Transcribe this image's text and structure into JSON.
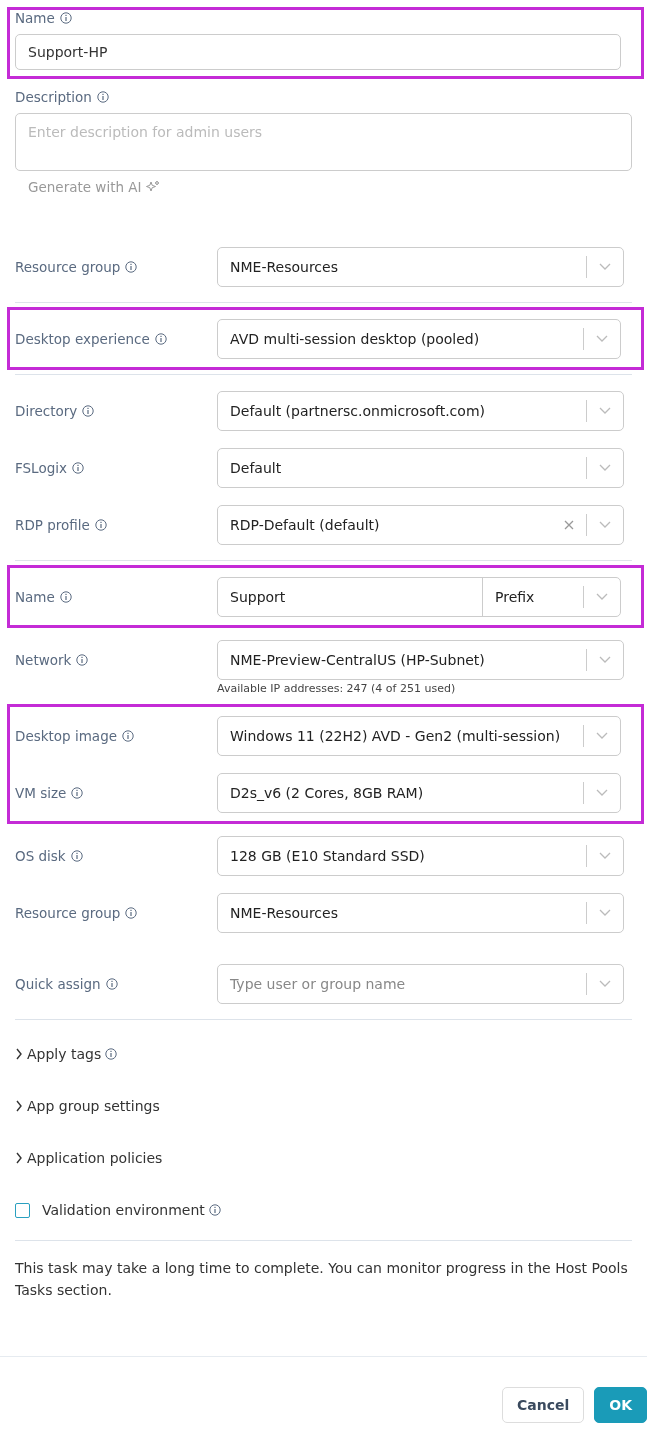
{
  "name_field": {
    "label": "Name",
    "value": "Support-HP",
    "highlighted": true
  },
  "description": {
    "label": "Description",
    "placeholder": "Enter description for admin users"
  },
  "generate_ai": {
    "label": "Generate with AI"
  },
  "groups": [
    {
      "highlighted": false,
      "divider": true,
      "rows": [
        {
          "kind": "select",
          "label": "Resource group",
          "value": "NME-Resources"
        }
      ]
    },
    {
      "highlighted": true,
      "divider": true,
      "rows": [
        {
          "kind": "select",
          "label": "Desktop experience",
          "value": "AVD multi-session desktop (pooled)"
        }
      ]
    },
    {
      "highlighted": false,
      "divider": true,
      "rows": [
        {
          "kind": "select",
          "label": "Directory",
          "value": "Default (partnersc.onmicrosoft.com)"
        },
        {
          "kind": "select",
          "label": "FSLogix",
          "value": "Default"
        },
        {
          "kind": "select",
          "label": "RDP profile",
          "value": "RDP-Default (default)",
          "clearable": true
        }
      ]
    },
    {
      "highlighted": true,
      "divider": false,
      "rows": [
        {
          "kind": "name-prefix",
          "label": "Name",
          "value": "Support",
          "suffix": "Prefix"
        }
      ]
    },
    {
      "highlighted": false,
      "divider": false,
      "rows": [
        {
          "kind": "select",
          "label": "Network",
          "value": "NME-Preview-CentralUS (HP-Subnet)",
          "note": "Available IP addresses: 247 (4 of 251 used)"
        }
      ]
    },
    {
      "highlighted": true,
      "divider": false,
      "rows": [
        {
          "kind": "select",
          "label": "Desktop image",
          "value": "Windows 11 (22H2) AVD - Gen2 (multi-session)"
        },
        {
          "kind": "select",
          "label": "VM size",
          "value": "D2s_v6 (2 Cores, 8GB RAM)"
        }
      ]
    },
    {
      "highlighted": false,
      "divider": true,
      "rows": [
        {
          "kind": "select",
          "label": "OS disk",
          "value": "128 GB (E10 Standard SSD)"
        },
        {
          "kind": "select",
          "label": "Resource group",
          "value": "NME-Resources"
        },
        {
          "kind": "picker",
          "label": "Quick assign",
          "placeholder": "Type user or group name"
        }
      ]
    }
  ],
  "sections": [
    {
      "label": "Apply tags",
      "info": true,
      "expanded": false
    },
    {
      "label": "App group settings",
      "info": false,
      "expanded": false
    },
    {
      "label": "Application policies",
      "info": false,
      "expanded": false
    }
  ],
  "validation": {
    "label": "Validation environment",
    "checked": false
  },
  "notice": "This task may take a long time to complete. You can monitor progress in the Host Pools Tasks section.",
  "buttons": [
    {
      "label": "Cancel",
      "kind": "secondary"
    },
    {
      "label": "OK",
      "kind": "primary"
    }
  ]
}
